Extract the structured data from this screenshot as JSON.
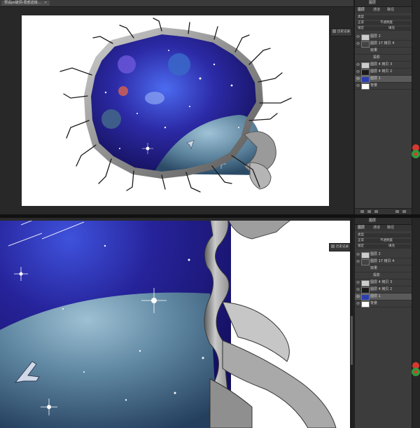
{
  "document": {
    "tab_title": "预设ps破洞-局部滤镜...",
    "tab_close": "×"
  },
  "panel": {
    "header": "图层",
    "tabs": [
      "图层",
      "通道",
      "路径"
    ],
    "filter_label": "类型",
    "blend_mode": "正常",
    "opacity_label": "不透明度",
    "lock_label": "锁定",
    "fill_label": "填充",
    "layers": [
      {
        "name": "图层 2",
        "thumb_color": "#cccccc"
      },
      {
        "name": "图层 17 拷贝 4",
        "thumb_color": "#444444"
      },
      {
        "name": "效果",
        "thumb_color": ""
      },
      {
        "name": "投影",
        "thumb_color": ""
      },
      {
        "name": "图层 4 拷贝 3",
        "thumb_color": "#cccccc"
      },
      {
        "name": "图层 4 拷贝 2",
        "thumb_color": "#1a1a1a"
      },
      {
        "name": "图层 1",
        "thumb_color": "#2a3fb0"
      },
      {
        "name": "背景",
        "thumb_color": "#ffffff"
      }
    ]
  },
  "history_button": "历史记录",
  "colors": {
    "workspace": "#282828",
    "panel": "#3c3c3c",
    "active_layer": "#5a5a5a",
    "space_deep": "#1b1770",
    "space_mid": "#3b4ad6",
    "planet": "#6d94ad",
    "wall_edge": "#9a9a9a",
    "badge_red": "#d63a2f",
    "badge_green": "#2f9b3c"
  },
  "icons": [
    "eye-icon",
    "layer-thumbnail-icon",
    "link-icon",
    "fx-icon",
    "mask-icon",
    "new-layer-icon",
    "trash-icon",
    "history-icon",
    "spaceship-icon"
  ]
}
